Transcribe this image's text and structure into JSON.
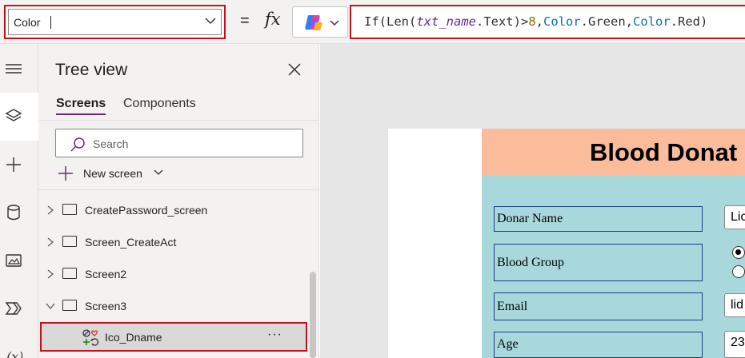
{
  "formula_bar": {
    "property": "Color",
    "equals": "=",
    "fx": "fx",
    "formula": {
      "fn_if": "If(",
      "fn_len": "Len(",
      "control": "txt_name",
      "prop": ".Text)>",
      "number": "8",
      "comma1": ",",
      "green": "Color",
      "green_member": ".Green,",
      "red": "Color",
      "red_member": ".Red)"
    }
  },
  "rail": {
    "items": [
      "hamburger-icon",
      "layers-icon",
      "plus-icon",
      "database-icon",
      "media-icon",
      "power-automate-icon",
      "variables-icon"
    ]
  },
  "tree": {
    "title": "Tree view",
    "tabs": [
      {
        "label": "Screens",
        "active": true
      },
      {
        "label": "Components",
        "active": false
      }
    ],
    "search_placeholder": "Search",
    "new_screen_label": "New screen",
    "items": [
      {
        "label": "CreatePassword_screen",
        "expanded": false
      },
      {
        "label": "Screen_CreateAct",
        "expanded": false
      },
      {
        "label": "Screen2",
        "expanded": false
      },
      {
        "label": "Screen3",
        "expanded": true
      }
    ],
    "selected_child": {
      "label": "Ico_Dname",
      "more": "···"
    }
  },
  "canvas": {
    "title": "Blood Donat",
    "fields": [
      {
        "label": "Donar Name",
        "value": "Lic"
      },
      {
        "label": "Blood Group",
        "value": ""
      },
      {
        "label": "Email",
        "value": "lid"
      },
      {
        "label": "Age",
        "value": "23"
      }
    ],
    "colors": {
      "title_band": "#fbbc9c",
      "form_bg": "#a8d8dc",
      "highlight": "#c50f1f"
    }
  }
}
